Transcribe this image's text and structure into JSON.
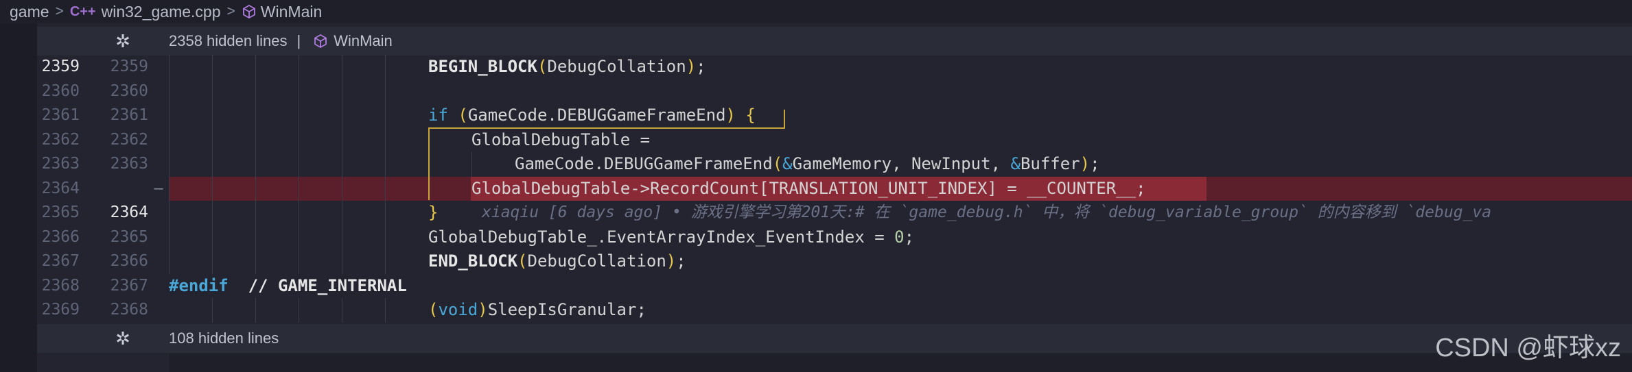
{
  "breadcrumb": {
    "folder": "game",
    "file_icon": "C++",
    "file": "win32_game.cpp",
    "symbol": "WinMain"
  },
  "fold_top": {
    "text": "2358 hidden lines",
    "separator": "|",
    "symbol": "WinMain"
  },
  "fold_bottom": {
    "text": "108 hidden lines"
  },
  "lines": [
    {
      "left": "2359",
      "right": "2359"
    },
    {
      "left": "2360",
      "right": "2360"
    },
    {
      "left": "2361",
      "right": "2361"
    },
    {
      "left": "2362",
      "right": "2362"
    },
    {
      "left": "2363",
      "right": "2363"
    },
    {
      "left": "2364",
      "right": "",
      "marker": "—"
    },
    {
      "left": "2365",
      "right": "2364"
    },
    {
      "left": "2366",
      "right": "2365"
    },
    {
      "left": "2367",
      "right": "2366"
    },
    {
      "left": "2368",
      "right": "2367"
    },
    {
      "left": "2369",
      "right": "2368"
    }
  ],
  "code": {
    "l1_fn": "BEGIN_BLOCK",
    "l1_arg": "DebugCollation",
    "l1_end": ";",
    "l3_kw": "if",
    "l3_expr": "GameCode.DEBUGGameFrameEnd",
    "l3_brace": "{",
    "l4": "GlobalDebugTable =",
    "l5_a": "GameCode.DEBUGGameFrameEnd",
    "l5_amp1": "&",
    "l5_b": "GameMemory, NewInput, ",
    "l5_amp2": "&",
    "l5_c": "Buffer",
    "l5_end": ";",
    "l6": "GlobalDebugTable->RecordCount[TRANSLATION_UNIT_INDEX] = __COUNTER__;",
    "l7_brace": "}",
    "l7_blame": "xiaqiu [6 days ago] • 游戏引擎学习第201天:# 在 `game_debug.h` 中，将 `debug_variable_group` 的内容移到 `debug_va",
    "l8_a": "GlobalDebugTable_.EventArrayIndex_EventIndex = ",
    "l8_num": "0",
    "l8_end": ";",
    "l9_fn": "END_BLOCK",
    "l9_arg": "DebugCollation",
    "l9_end": ";",
    "l10_kw": "#endif",
    "l10_cmt": "  // GAME_INTERNAL",
    "l11_kw": "void",
    "l11_fn": "SleepIsGranular",
    "l11_end": ";"
  },
  "watermark": "CSDN @虾球xz",
  "colors": {
    "deleted_bg": "#5a1f2a",
    "deleted_highlight": "#8a2a36",
    "keyword": "#4aa8d8",
    "paren": "#e8c84a"
  }
}
